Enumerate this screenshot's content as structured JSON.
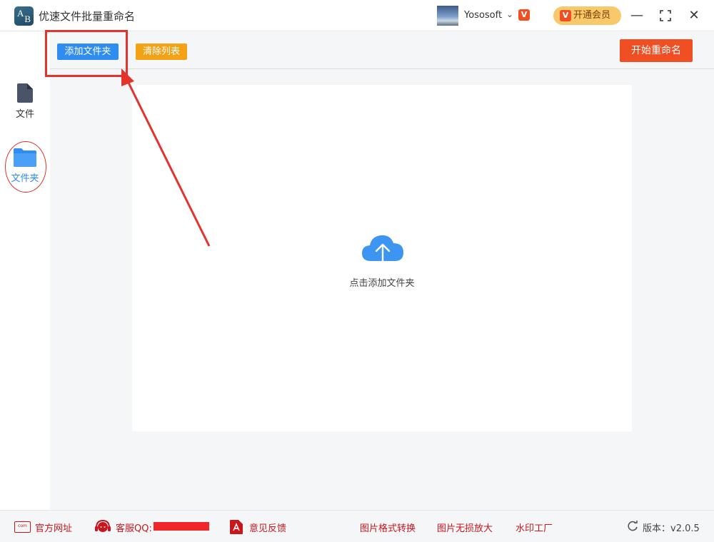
{
  "app": {
    "title": "优速文件批量重命名",
    "logo_a": "A",
    "logo_b": "B"
  },
  "user": {
    "name": "Yososoft",
    "vip_badge": "V",
    "vip_button_label": "开通会员"
  },
  "window_controls": {
    "minimize": "—",
    "maximize": "⛶",
    "close": "✕"
  },
  "sidebar": {
    "items": [
      {
        "label": "文件",
        "icon": "file-icon",
        "active": false
      },
      {
        "label": "文件夹",
        "icon": "folder-icon",
        "active": true
      }
    ]
  },
  "toolbar": {
    "add_folder_label": "添加文件夹",
    "clear_list_label": "清除列表",
    "start_rename_label": "开始重命名"
  },
  "dropzone": {
    "icon": "cloud-upload-icon",
    "text": "点击添加文件夹"
  },
  "footer": {
    "site_label": "官方网址",
    "site_icon_text": "com",
    "qq_label": "客服QQ:",
    "feedback_label": "意见反馈",
    "links": [
      "图片格式转换",
      "图片无损放大",
      "水印工厂"
    ],
    "version_label": "版本：v2.0.5"
  },
  "colors": {
    "primary_blue": "#2f8cf0",
    "orange": "#f4a215",
    "red_orange": "#f04e23",
    "annotation_red": "#e2332d",
    "footer_red": "#c8161d"
  }
}
